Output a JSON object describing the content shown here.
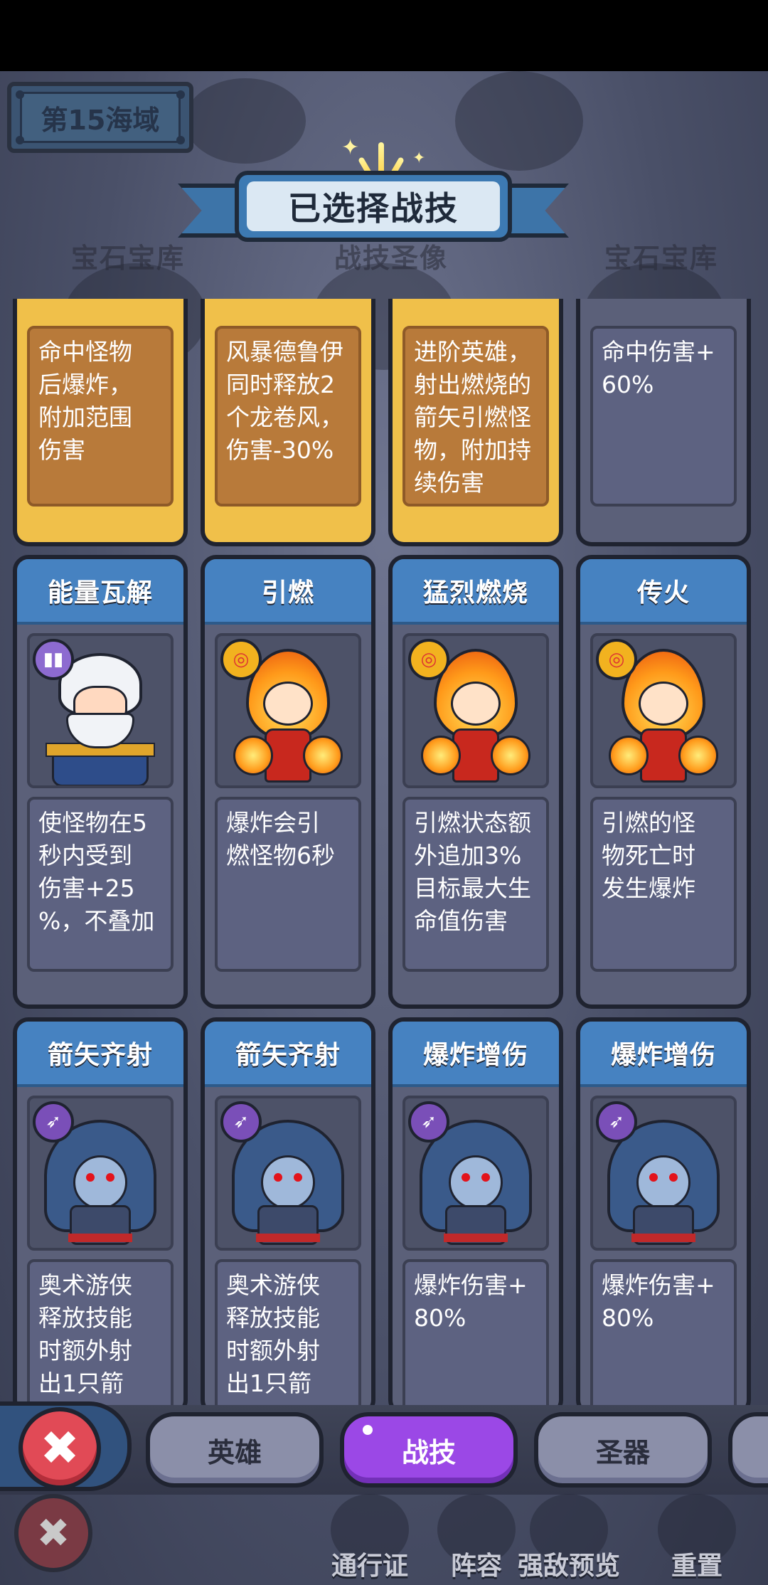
{
  "header": {
    "area_label": "第15海域",
    "banner_title": "已选择战技"
  },
  "background_labels": [
    "宝石宝库",
    "战技圣像",
    "宝石宝库"
  ],
  "cards_row1": [
    {
      "desc": "命中怪物\n后爆炸，\n附加范围\n伤害",
      "rarity": "gold"
    },
    {
      "desc": "风暴德鲁伊\n同时释放2\n个龙卷风，\n伤害-30%",
      "rarity": "gold"
    },
    {
      "desc": "进阶英雄，\n射出燃烧的\n箭矢引燃怪\n物，附加持\n续伤害",
      "rarity": "gold"
    },
    {
      "desc": "命中伤害+\n60%",
      "rarity": "normal"
    }
  ],
  "cards_row2": [
    {
      "title": "能量瓦解",
      "icon": "purple-crystal-icon",
      "character": "storm-druid",
      "desc": "使怪物在5\n秒内受到\n伤害+25\n%，不叠加"
    },
    {
      "title": "引燃",
      "icon": "fire-ring-icon",
      "character": "fire-spirit",
      "desc": "爆炸会引\n燃怪物6秒"
    },
    {
      "title": "猛烈燃烧",
      "icon": "fire-ring-icon",
      "character": "fire-spirit",
      "desc": "引燃状态额\n外追加3%\n目标最大生\n命值伤害"
    },
    {
      "title": "传火",
      "icon": "fire-ring-icon",
      "character": "fire-spirit",
      "desc": "引燃的怪\n物死亡时\n发生爆炸"
    }
  ],
  "cards_row3": [
    {
      "title": "箭矢齐射",
      "icon": "arrow-volley-icon",
      "character": "arcane-ranger",
      "desc": "奥术游侠\n释放技能\n时额外射\n出1只箭"
    },
    {
      "title": "箭矢齐射",
      "icon": "arrow-volley-icon",
      "character": "arcane-ranger",
      "desc": "奥术游侠\n释放技能\n时额外射\n出1只箭"
    },
    {
      "title": "爆炸增伤",
      "icon": "arrow-volley-icon",
      "character": "arcane-ranger",
      "desc": "爆炸伤害+\n80%"
    },
    {
      "title": "爆炸增伤",
      "icon": "arrow-volley-icon",
      "character": "arcane-ranger",
      "desc": "爆炸伤害+\n80%"
    }
  ],
  "tabs": {
    "hero": "英雄",
    "skill": "战技",
    "artifact": "圣器"
  },
  "lower_menu": {
    "pass": "通行证",
    "lineup": "阵容",
    "preview": "强敌预览",
    "reset": "重置"
  },
  "colors": {
    "gold_card": "#f0c04a",
    "title_blue": "#4682c1",
    "active_tab": "#9b48e6",
    "close_red": "#e14a56"
  }
}
